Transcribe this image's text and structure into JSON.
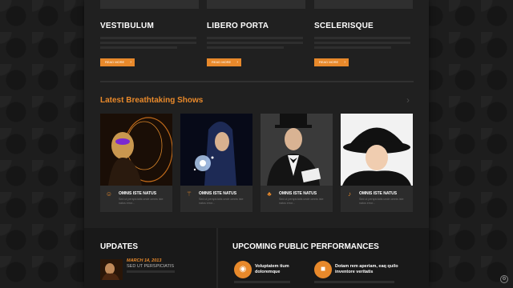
{
  "features": [
    {
      "title": "VESTIBULUM",
      "button": "READ MORE"
    },
    {
      "title": "LIBERO PORTA",
      "button": "READ MORE"
    },
    {
      "title": "SCELERISQUE",
      "button": "READ MORE"
    }
  ],
  "shows_section": {
    "title": "Latest Breathtaking Shows",
    "next_icon": "chevron-right-icon",
    "cards": [
      {
        "caption": "OMNIS ISTE NATUS",
        "desc": "Sed ut perspiciatis unde omnis iste natus error...",
        "icon": "mask-icon"
      },
      {
        "caption": "OMNIS ISTE NATUS",
        "desc": "Sed ut perspiciatis unde omnis iste natus error...",
        "icon": "magic-wand-icon"
      },
      {
        "caption": "OMNIS ISTE NATUS",
        "desc": "Sed ut perspiciatis unde omnis iste natus error...",
        "icon": "rabbit-icon"
      },
      {
        "caption": "OMNIS ISTE NATUS",
        "desc": "Sed ut perspiciatis unde omnis iste natus error...",
        "icon": "microphone-icon"
      }
    ]
  },
  "updates": {
    "title": "UPDATES",
    "item": {
      "date": "MARCH 14, 2013",
      "headline": "SED UT PERSPICIATIS"
    }
  },
  "performances": {
    "title": "UPCOMING PUBLIC PERFORMANCES",
    "items": [
      {
        "title": "Voluptatem tium doloremque",
        "icon": "eye-icon"
      },
      {
        "title": "Dotam rem aperiam, eaq quilo inventore veritatis",
        "icon": "video-camera-icon"
      }
    ]
  },
  "colors": {
    "accent": "#e8892b",
    "panel": "#202020",
    "card": "#2c2c2c"
  }
}
